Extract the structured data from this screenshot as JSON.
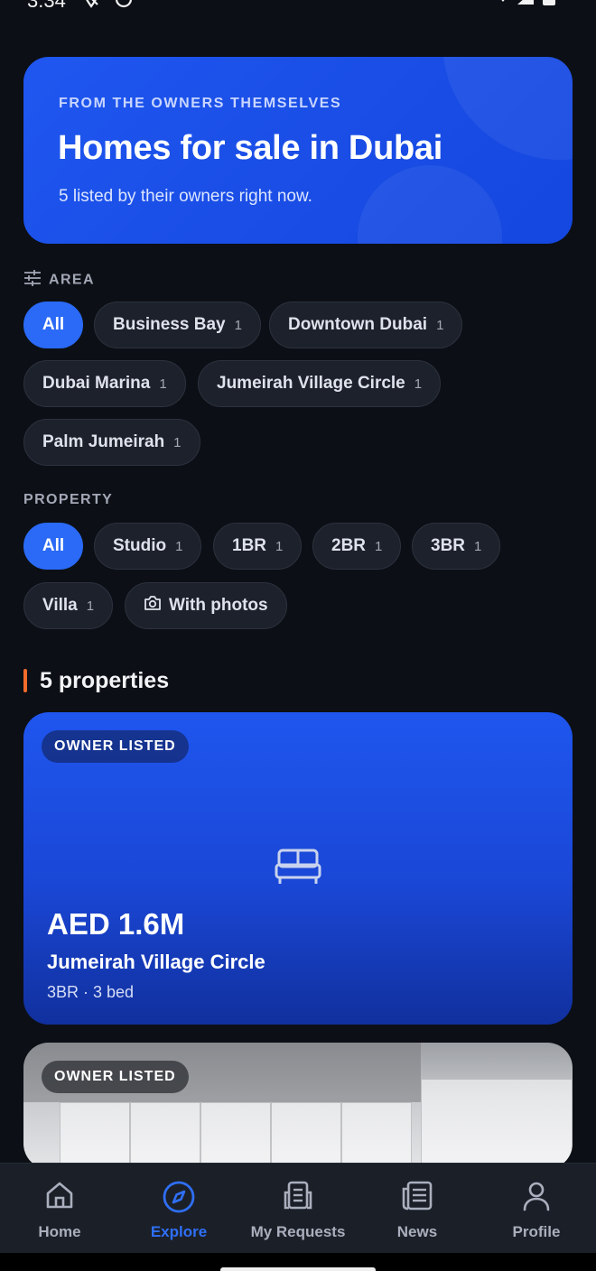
{
  "status_bar": {
    "time": "3:34"
  },
  "hero": {
    "eyebrow": "FROM THE OWNERS THEMSELVES",
    "title": "Homes for sale in Dubai",
    "subtitle": "5 listed by their owners right now."
  },
  "area_filter": {
    "label": "AREA",
    "icon": "sliders-icon",
    "chips": [
      {
        "label": "All",
        "count": "",
        "active": true
      },
      {
        "label": "Business Bay",
        "count": "1"
      },
      {
        "label": "Downtown Dubai",
        "count": "1"
      },
      {
        "label": "Dubai Marina",
        "count": "1"
      },
      {
        "label": "Jumeirah Village Circle",
        "count": "1"
      },
      {
        "label": "Palm Jumeirah",
        "count": "1"
      }
    ]
  },
  "property_filter": {
    "label": "PROPERTY",
    "chips": [
      {
        "label": "All",
        "count": "",
        "active": true
      },
      {
        "label": "Studio",
        "count": "1"
      },
      {
        "label": "1BR",
        "count": "1"
      },
      {
        "label": "2BR",
        "count": "1"
      },
      {
        "label": "3BR",
        "count": "1"
      },
      {
        "label": "Villa",
        "count": "1"
      },
      {
        "label": "With photos",
        "count": "",
        "icon": "camera-icon"
      }
    ]
  },
  "results": {
    "count_label": "5 properties"
  },
  "listings": [
    {
      "badge": "OWNER LISTED",
      "price": "AED 1.6M",
      "area": "Jumeirah Village Circle",
      "meta": "3BR · 3 bed",
      "icon": "bed-icon"
    },
    {
      "badge": "OWNER LISTED"
    }
  ],
  "bottom_nav": [
    {
      "label": "Home",
      "icon": "home-icon"
    },
    {
      "label": "Explore",
      "icon": "compass-icon",
      "active": true
    },
    {
      "label": "My Requests",
      "icon": "requests-icon"
    },
    {
      "label": "News",
      "icon": "news-icon"
    },
    {
      "label": "Profile",
      "icon": "profile-icon"
    }
  ],
  "colors": {
    "accent": "#2a6af6",
    "background": "#0c0f15",
    "hero": "#1f57f0",
    "results_marker": "#f26b2b"
  }
}
